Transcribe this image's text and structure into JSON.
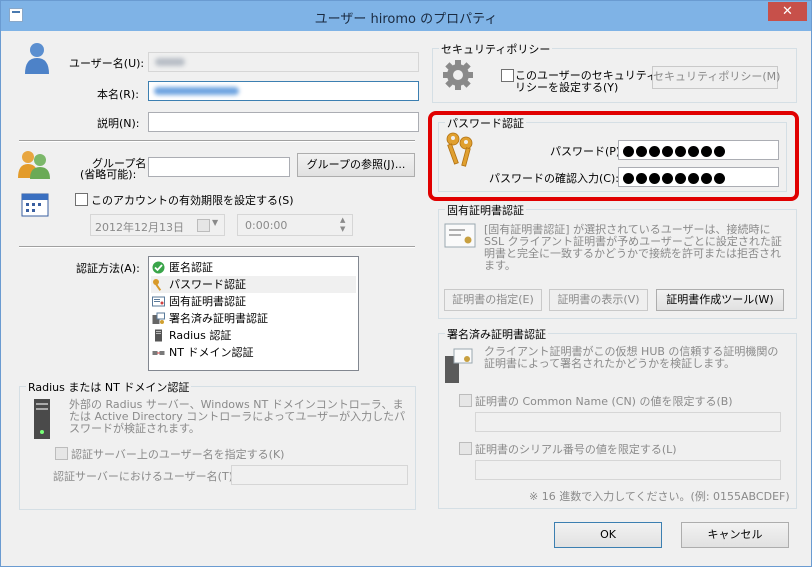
{
  "window": {
    "title": "ユーザー hiromo のプロパティ",
    "close_glyph": "✕"
  },
  "user": {
    "username_label": "ユーザー名(U):",
    "realname_label": "本名(R):",
    "description_label": "説明(N):"
  },
  "group": {
    "label_line1": "グループ名",
    "label_line2": "(省略可能):",
    "browse_button": "グループの参照(J)..."
  },
  "expiry": {
    "checkbox_label": "このアカウントの有効期限を設定する(S)",
    "date_value": "2012年12月13日",
    "time_value": "0:00:00"
  },
  "auth": {
    "label": "認証方法(A):",
    "options": [
      {
        "label": "匿名認証",
        "icon": "check-icon"
      },
      {
        "label": "パスワード認証",
        "icon": "key-icon"
      },
      {
        "label": "固有証明書認証",
        "icon": "certificate-icon"
      },
      {
        "label": "署名済み証明書認証",
        "icon": "signed-certificate-icon"
      },
      {
        "label": "Radius 認証",
        "icon": "server-icon"
      },
      {
        "label": "NT ドメイン認証",
        "icon": "domain-icon"
      }
    ]
  },
  "radius": {
    "legend": "Radius または NT ドメイン認証",
    "description": "外部の Radius サーバー、Windows NT ドメインコントローラ、または Active Directory コントローラによってユーザーが入力したパスワードが検証されます。",
    "checkbox_label": "認証サーバー上のユーザー名を指定する(K)",
    "server_username_label": "認証サーバーにおけるユーザー名(T):"
  },
  "security_policy": {
    "legend": "セキュリティポリシー",
    "checkbox_label_line1": "このユーザーのセキュリティポ",
    "checkbox_label_line2": "リシーを設定する(Y)",
    "button": "セキュリティポリシー(M)"
  },
  "password": {
    "legend": "パスワード認証",
    "password_label": "パスワード(P):",
    "confirm_label": "パスワードの確認入力(C):",
    "dot_count": 8
  },
  "cert": {
    "legend": "固有証明書認証",
    "description": "[固有証明書認証] が選択されているユーザーは、接続時に SSL クライアント証明書が予めユーザーごとに設定された証明書と完全に一致するかどうかで接続を許可または拒否されます。",
    "specify_button": "証明書の指定(E)",
    "view_button": "証明書の表示(V)",
    "create_button": "証明書作成ツール(W)"
  },
  "signed": {
    "legend": "署名済み証明書認証",
    "description": "クライアント証明書がこの仮想 HUB の信頼する証明機関の証明書によって署名されたかどうかを検証します。",
    "cn_checkbox": "証明書の Common Name (CN) の値を限定する(B)",
    "serial_checkbox": "証明書のシリアル番号の値を限定する(L)",
    "hint": "※ 16 進数で入力してください。(例: 0155ABCDEF)"
  },
  "footer": {
    "ok_button": "OK",
    "cancel_button": "キャンセル"
  }
}
